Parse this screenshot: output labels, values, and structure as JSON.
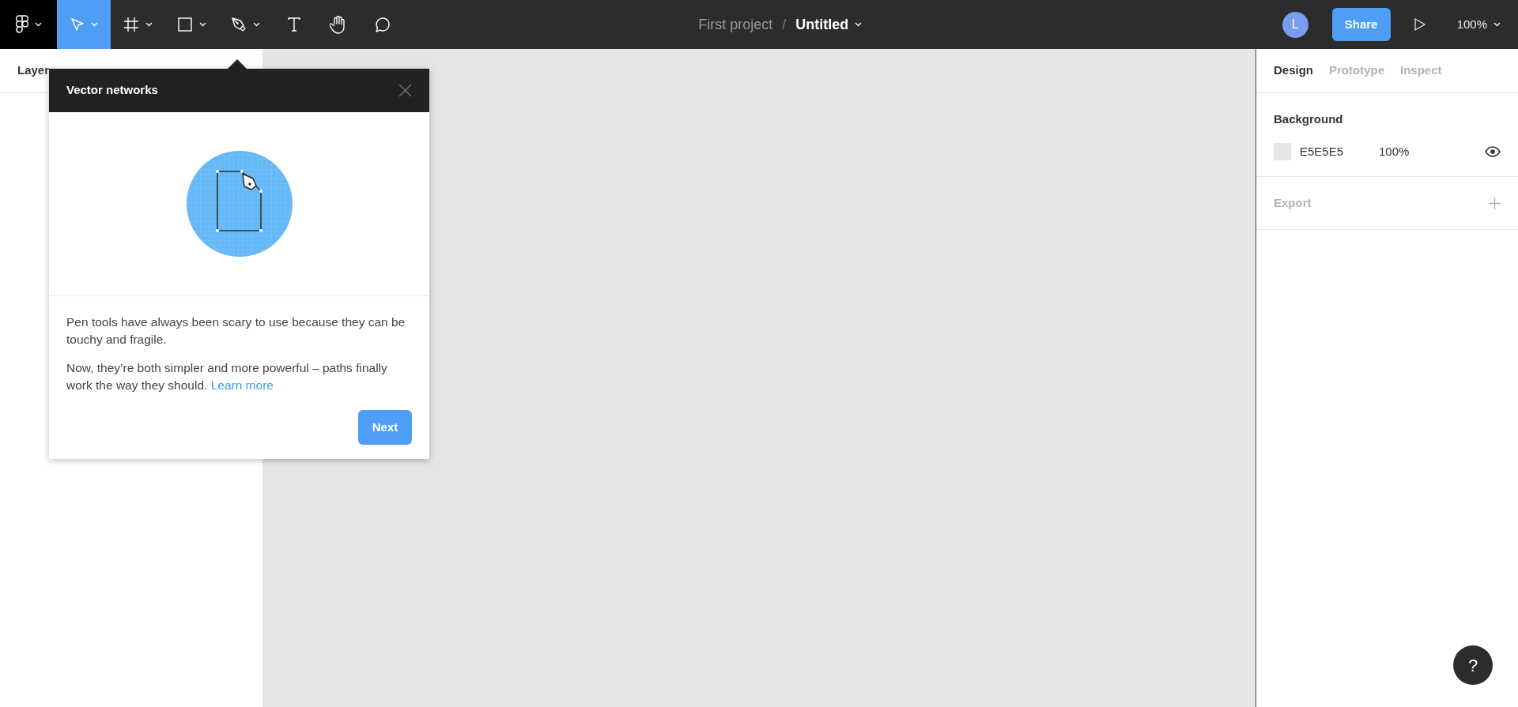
{
  "toolbar": {
    "tools": [
      {
        "kind": "move",
        "selected": true,
        "menu": true
      },
      {
        "kind": "frame",
        "selected": false,
        "menu": true
      },
      {
        "kind": "shape",
        "selected": false,
        "menu": true
      },
      {
        "kind": "pen",
        "selected": false,
        "menu": true
      },
      {
        "kind": "text",
        "selected": false,
        "menu": false
      },
      {
        "kind": "hand",
        "selected": false,
        "menu": false
      },
      {
        "kind": "comment",
        "selected": false,
        "menu": false
      }
    ],
    "project": "First project",
    "separator": "/",
    "file": "Untitled",
    "avatar": "L",
    "share": "Share",
    "zoom": "100%"
  },
  "left_panel": {
    "tab": "Layer"
  },
  "popup": {
    "title": "Vector networks",
    "paragraphs": [
      "Pen tools have always been scary to use because they can be touchy and fragile.",
      "Now, they’re both simpler and more powerful – paths finally work the way they should."
    ],
    "link": "Learn more",
    "button": "Next"
  },
  "right_panel": {
    "tabs": [
      {
        "label": "Design",
        "selected": true
      },
      {
        "label": "Prototype",
        "selected": false
      },
      {
        "label": "Inspect",
        "selected": false
      }
    ],
    "background": {
      "title": "Background",
      "color": "#e5e5e5",
      "hex": "E5E5E5",
      "opacity": "100%",
      "visible": true
    },
    "export": {
      "title": "Export"
    }
  },
  "help": "?"
}
